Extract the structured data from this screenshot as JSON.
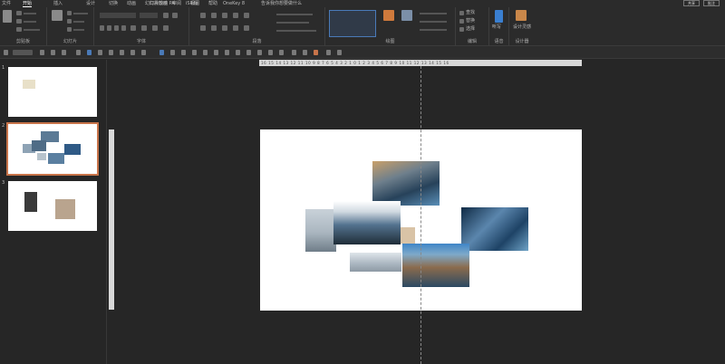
{
  "ribbon_tabs": [
    "文件",
    "开始",
    "插入",
    "设计",
    "切换",
    "动画",
    "幻灯片放映",
    "审阅",
    "视图",
    "帮助",
    "口袋动画 PA",
    "iSlide",
    "OneKey 8",
    "告诉我你想要做什么"
  ],
  "active_tab": "开始",
  "top_right_buttons": [
    "共享",
    "批注"
  ],
  "ribbon_groups": [
    "剪贴板",
    "幻灯片",
    "字体",
    "段落",
    "绘图",
    "编辑",
    "语音",
    "设计器"
  ],
  "ribbon_commands": {
    "paste": "粘贴",
    "new_slide": "新建幻灯片",
    "arrange": "排列",
    "quick_styles": "快速样式",
    "find": "查找",
    "replace": "替换",
    "select": "选择",
    "dictate": "听写",
    "design_ideas": "设计灵感"
  },
  "ruler_labels": "16 15 14 13 12 11 10 9 8 7 6 5 4 3 2 1 0 1 2 3 4 5 6 7 8 9 10 11 12 13 14 15 16",
  "slides": [
    {
      "number": "1"
    },
    {
      "number": "2",
      "selected": true
    },
    {
      "number": "3"
    }
  ],
  "colors": {
    "accent": "#c8744a",
    "background": "#262626",
    "ribbon": "#2b2b2b"
  }
}
